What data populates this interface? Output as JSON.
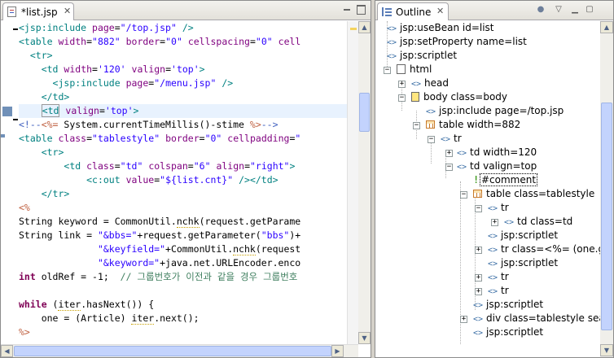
{
  "editor": {
    "tab_label": "*list.jsp",
    "tab_close": "✕",
    "code_lines": [
      "<jsp:include page=\"/top.jsp\" />",
      "<table width=\"882\" border=\"0\" cellspacing=\"0\" cell",
      "  <tr>",
      "    <td width='120' valign='top'>",
      "      <jsp:include page=\"/menu.jsp\" />",
      "    </td>",
      "    <td valign='top'>",
      "<!--<%= System.currentTimeMillis()-stime %>-->",
      "<table class=\"tablestyle\" border=\"0\" cellpadding=\"",
      "    <tr>",
      "        <td class=\"td\" colspan=\"6\" align=\"right\">",
      "            <c:out value=\"${list.cnt}\" /></td>",
      "    </tr>",
      "<%",
      "String keyword = CommonUtil.nchk(request.getParame",
      "String link = \"&bbs=\"+request.getParameter(\"bbs\")+",
      "              \"&keyfield=\"+CommonUtil.nchk(request",
      "              \"&keyword=\"+java.net.URLEncoder.enco",
      "int oldRef = -1;  // 그룹번호가 이전과 같을 경우 그룹번호 ",
      "",
      "while (iter.hasNext()) {",
      "    one = (Article) iter.next();",
      "%>"
    ]
  },
  "outline": {
    "tab_label": "Outline",
    "tab_close": "✕",
    "items": [
      "jsp:useBean id=list",
      "jsp:setProperty name=list",
      "jsp:scriptlet",
      "html",
      "head",
      "body class=body",
      "jsp:include page=/top.jsp",
      "table width=882",
      "tr",
      "td width=120",
      "td valign=top",
      "#comment",
      "table class=tablestyle",
      "tr",
      "td class=td",
      "jsp:scriptlet",
      "tr class=<%= (one.g",
      "jsp:scriptlet",
      "tr",
      "tr",
      "jsp:scriptlet",
      "div class=tablestyle sea",
      "jsp:scriptlet"
    ]
  }
}
